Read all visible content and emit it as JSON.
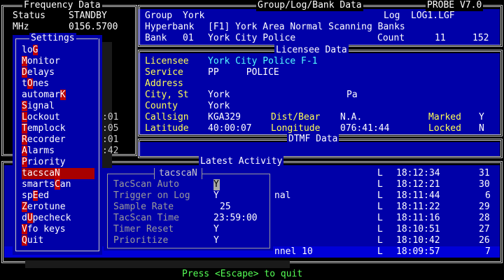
{
  "freq_panel": {
    "title": "Frequency Data",
    "status_label": "Status",
    "status_value": "STANDBY",
    "mhz_label": "MHz",
    "mhz_value": "0156.5700"
  },
  "group_panel": {
    "title": "Group/Log/Bank Data",
    "group_label": "Group",
    "group_value": "York",
    "log_label": "Log",
    "log_value": "LOG1.LGF",
    "hyperbank_label": "Hyperbank",
    "hyperbank_value": "[F1] York Area Normal Scanning Banks",
    "bank_label": "Bank",
    "bank_num": "01",
    "bank_name": "York City Police",
    "count_label": "Count",
    "count_a": "11",
    "count_b": "152"
  },
  "app_title": "PROBE V7.0",
  "licensee": {
    "title": "Licensee Data",
    "rows": [
      {
        "label": "Licensee",
        "value": "York City Police F-1"
      },
      {
        "label": "Service",
        "value": "PP     POLICE"
      },
      {
        "label": "Address",
        "value": ""
      },
      {
        "label": "City, St",
        "value": "York",
        "extra": "Pa"
      },
      {
        "label": "County",
        "value": "York"
      },
      {
        "label": "Callsign",
        "value": "KGA329"
      },
      {
        "label": "Latitude",
        "value": "40:00:07"
      }
    ],
    "dist_label": "Dist/Bear",
    "dist_value": "N.A.",
    "longitude_label": "Longitude",
    "longitude_value": "076:41:44",
    "marked_label": "Marked",
    "marked_value": "Y",
    "locked_label": "Locked",
    "locked_value": "N"
  },
  "dtmf_title": "DTMF Data",
  "activity": {
    "title": "Latest Activity",
    "rows": [
      {
        "name": "",
        "flag": "L",
        "time": "18:12:34",
        "count": "31"
      },
      {
        "name": "",
        "flag": "L",
        "time": "18:12:21",
        "count": "30"
      },
      {
        "name": "nal",
        "flag": "L",
        "time": "18:11:44",
        "count": "6"
      },
      {
        "name": "",
        "flag": "L",
        "time": "18:11:22",
        "count": "29"
      },
      {
        "name": "",
        "flag": "L",
        "time": "18:11:16",
        "count": "28"
      },
      {
        "name": "",
        "flag": "L",
        "time": "18:10:51",
        "count": "27"
      },
      {
        "name": "",
        "flag": "L",
        "time": "18:10:42",
        "count": "26"
      },
      {
        "name": "nnel 10",
        "flag": "L",
        "time": "18:09:57",
        "count": "7"
      }
    ]
  },
  "settings": {
    "title": "Settings",
    "items": [
      {
        "pre": "lo",
        "hot": "G",
        "post": ""
      },
      {
        "pre": "",
        "hot": "M",
        "post": "onitor"
      },
      {
        "pre": "",
        "hot": "D",
        "post": "elays"
      },
      {
        "pre": "t",
        "hot": "O",
        "post": "nes"
      },
      {
        "pre": "automar",
        "hot": "K",
        "post": ""
      },
      {
        "pre": "",
        "hot": "S",
        "post": "ignal"
      },
      {
        "pre": "",
        "hot": "L",
        "post": "ockout"
      },
      {
        "pre": "",
        "hot": "T",
        "post": "emplock"
      },
      {
        "pre": "",
        "hot": "R",
        "post": "ecorder"
      },
      {
        "pre": "",
        "hot": "A",
        "post": "larms"
      },
      {
        "pre": "",
        "hot": "P",
        "post": "riority"
      },
      {
        "pre": "tacsca",
        "hot": "N",
        "post": ""
      },
      {
        "pre": "smarts",
        "hot": "C",
        "post": "an"
      },
      {
        "pre": "sp",
        "hot": "E",
        "post": "ed"
      },
      {
        "pre": "",
        "hot": "Z",
        "post": "erotune"
      },
      {
        "pre": "d",
        "hot": "U",
        "post": "pecheck"
      },
      {
        "pre": "",
        "hot": "V",
        "post": "fo keys"
      },
      {
        "pre": "",
        "hot": "Q",
        "post": "uit"
      }
    ],
    "side_values": [
      ":01",
      ":05",
      ":01",
      ":42"
    ]
  },
  "tacscan": {
    "title": "tacscaN",
    "rows": [
      {
        "label": "TacScan Auto",
        "value": "Y"
      },
      {
        "label": "Trigger on Log",
        "value": "Y"
      },
      {
        "label": "Sample Rate",
        "value": "25"
      },
      {
        "label": "TacScan Time",
        "value": "23:59:00"
      },
      {
        "label": "Timer Reset",
        "value": "Y"
      },
      {
        "label": "Prioritize",
        "value": "Y"
      }
    ]
  },
  "footer": "Press <Escape> to quit"
}
